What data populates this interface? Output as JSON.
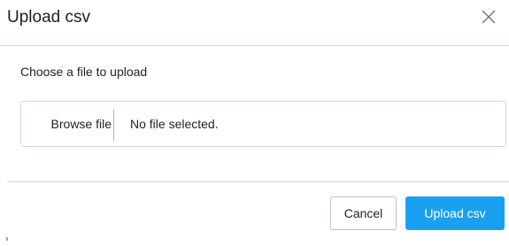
{
  "dialog": {
    "title": "Upload csv",
    "close_icon": "close-icon"
  },
  "body": {
    "prompt": "Choose a file to upload",
    "file_input": {
      "browse_label": "Browse file",
      "status": "No file selected."
    }
  },
  "footer": {
    "cancel_label": "Cancel",
    "submit_label": "Upload csv"
  },
  "colors": {
    "accent": "#1aa0f0",
    "border": "#c9d9e0"
  }
}
